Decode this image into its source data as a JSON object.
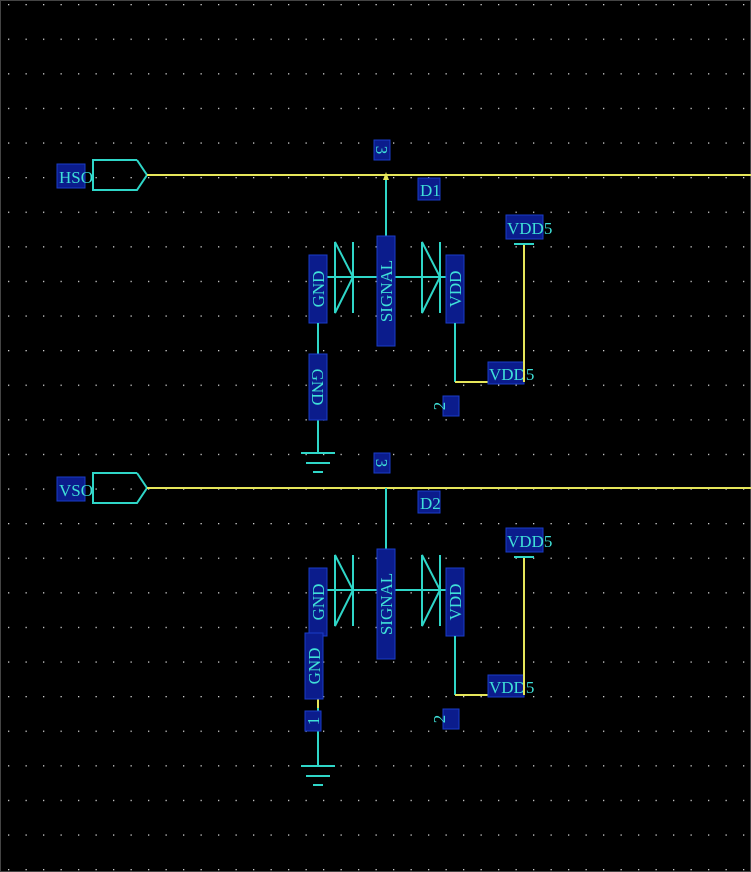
{
  "colors": {
    "background": "#000000",
    "grid_dot": "#cfcfcf",
    "component": "#2fd6c8",
    "wire": "#e6e65a",
    "label_box": "#0b1c8c"
  },
  "ports": [
    {
      "name": "HSO"
    },
    {
      "name": "VSO"
    }
  ],
  "blocks": [
    {
      "ref": "D1",
      "pin_signal": "3",
      "pin_vdd": "2",
      "pin_gnd": "",
      "label_gnd": "GND",
      "label_signal": "SIGNAL",
      "label_vdd": "VDD",
      "net_gnd": "GND",
      "net_vdd_top": "VDD5",
      "net_vdd_bottom": "VDD5"
    },
    {
      "ref": "D2",
      "pin_signal": "3",
      "pin_vdd": "2",
      "pin_gnd": "1",
      "label_gnd": "GND",
      "label_signal": "SIGNAL",
      "label_vdd": "VDD",
      "net_gnd": "GND",
      "net_vdd_top": "VDD5",
      "net_vdd_bottom": "VDD5"
    }
  ]
}
